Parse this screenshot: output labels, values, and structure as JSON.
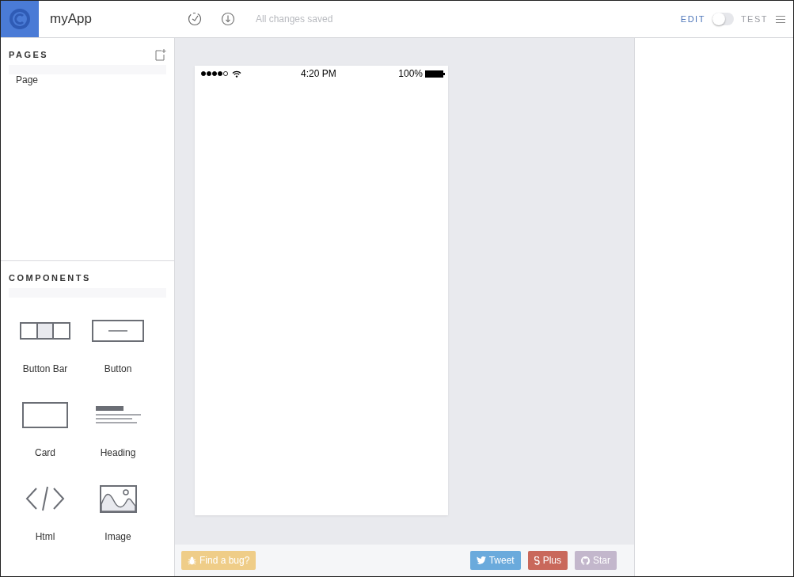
{
  "header": {
    "app_name": "myApp",
    "save_status": "All changes saved",
    "modes": [
      {
        "label": "EDIT",
        "selected": true
      },
      {
        "label": "TEST",
        "selected": false
      }
    ]
  },
  "pages": {
    "title": "PAGES",
    "items": [
      {
        "label": "Page",
        "selected": false
      }
    ]
  },
  "components": {
    "title": "COMPONENTS",
    "items": [
      {
        "kind": "button-bar",
        "label": "Button Bar"
      },
      {
        "kind": "button",
        "label": "Button"
      },
      {
        "kind": "card",
        "label": "Card"
      },
      {
        "kind": "heading",
        "label": "Heading"
      },
      {
        "kind": "html",
        "label": "Html"
      },
      {
        "kind": "image",
        "label": "Image"
      }
    ]
  },
  "phone": {
    "time": "4:20 PM",
    "battery": "100%"
  },
  "footer": {
    "left": [
      {
        "kind": "bug",
        "label": "Find a bug?",
        "color": "#efcd88"
      }
    ],
    "right": [
      {
        "kind": "twitter",
        "label": "Tweet",
        "color": "#6aaadc"
      },
      {
        "kind": "gplus",
        "label": "Plus",
        "color": "#c9685b"
      },
      {
        "kind": "github",
        "label": "Star",
        "color": "#c3b7cc"
      }
    ]
  }
}
